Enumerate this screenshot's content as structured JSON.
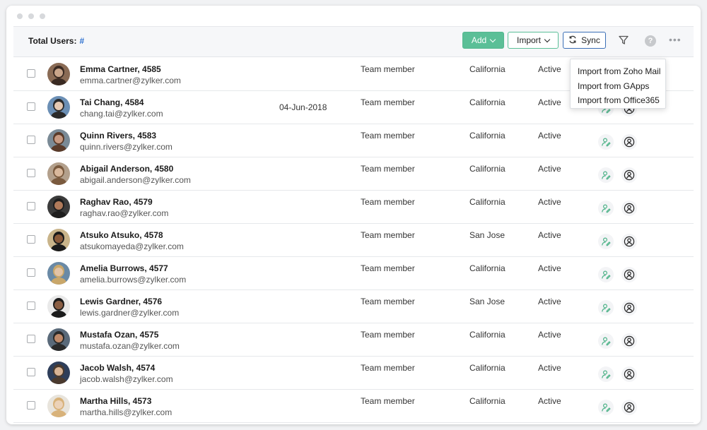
{
  "toolbar": {
    "total_label": "Total Users:",
    "total_value": "#",
    "add_label": "Add",
    "import_label": "Import",
    "sync_label": "Sync"
  },
  "import_menu": {
    "items": [
      "Import from Zoho Mail",
      "Import from GApps",
      "Import from Office365"
    ]
  },
  "colors": {
    "accent_green": "#5bbf97",
    "link_blue": "#2b6fcf"
  },
  "icons": {
    "filter": "filter-icon",
    "help": "help-icon",
    "more": "more-icon",
    "sync": "sync-icon",
    "user_action": "user-edit-icon",
    "user_role": "user-role-icon"
  },
  "users": [
    {
      "name": "Emma Cartner, 4585",
      "email": "emma.cartner@zylker.com",
      "date": "",
      "role": "Team member",
      "location": "California",
      "status": "Active"
    },
    {
      "name": "Tai Chang, 4584",
      "email": "chang.tai@zylker.com",
      "date": "04-Jun-2018",
      "role": "Team member",
      "location": "California",
      "status": "Active"
    },
    {
      "name": "Quinn Rivers, 4583",
      "email": "quinn.rivers@zylker.com",
      "date": "",
      "role": "Team member",
      "location": "California",
      "status": "Active"
    },
    {
      "name": "Abigail Anderson, 4580",
      "email": "abigail.anderson@zylker.com",
      "date": "",
      "role": "Team member",
      "location": "California",
      "status": "Active"
    },
    {
      "name": "Raghav Rao, 4579",
      "email": "raghav.rao@zylker.com",
      "date": "",
      "role": "Team member",
      "location": "California",
      "status": "Active"
    },
    {
      "name": "Atsuko Atsuko, 4578",
      "email": "atsukomayeda@zylker.com",
      "date": "",
      "role": "Team member",
      "location": "San Jose",
      "status": "Active"
    },
    {
      "name": "Amelia Burrows, 4577",
      "email": "amelia.burrows@zylker.com",
      "date": "",
      "role": "Team member",
      "location": "California",
      "status": "Active"
    },
    {
      "name": "Lewis Gardner, 4576",
      "email": "lewis.gardner@zylker.com",
      "date": "",
      "role": "Team member",
      "location": "San Jose",
      "status": "Active"
    },
    {
      "name": "Mustafa Ozan, 4575",
      "email": "mustafa.ozan@zylker.com",
      "date": "",
      "role": "Team member",
      "location": "California",
      "status": "Active"
    },
    {
      "name": "Jacob Walsh, 4574",
      "email": "jacob.walsh@zylker.com",
      "date": "",
      "role": "Team member",
      "location": "California",
      "status": "Active"
    },
    {
      "name": "Martha Hills, 4573",
      "email": "martha.hills@zylker.com",
      "date": "",
      "role": "Team member",
      "location": "California",
      "status": "Active"
    }
  ]
}
